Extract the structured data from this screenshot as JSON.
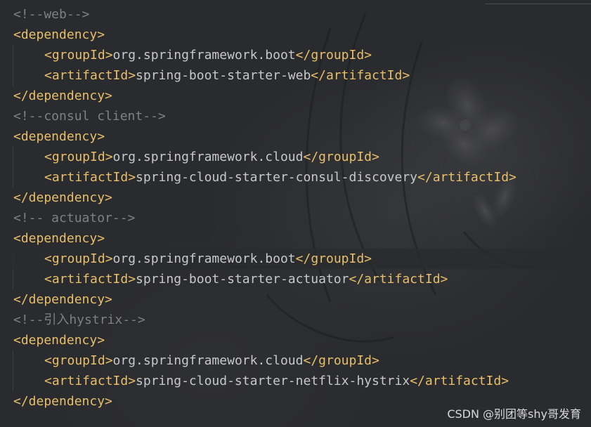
{
  "code_lines": [
    {
      "indent": 0,
      "comment": "<!--web-->"
    },
    {
      "indent": 0,
      "open": "<dependency>"
    },
    {
      "indent": 1,
      "open": "<groupId>",
      "text": "org.springframework.boot",
      "close": "</groupId>"
    },
    {
      "indent": 1,
      "open": "<artifactId>",
      "text": "spring-boot-starter-web",
      "close": "</artifactId>"
    },
    {
      "indent": 0,
      "close": "</dependency>"
    },
    {
      "indent": 0,
      "comment": "<!--consul client-->"
    },
    {
      "indent": 0,
      "open": "<dependency>"
    },
    {
      "indent": 1,
      "open": "<groupId>",
      "text": "org.springframework.cloud",
      "close": "</groupId>"
    },
    {
      "indent": 1,
      "open": "<artifactId>",
      "text": "spring-cloud-starter-consul-discovery",
      "close": "</artifactId>"
    },
    {
      "indent": 0,
      "close": "</dependency>"
    },
    {
      "indent": 0,
      "comment": "<!-- actuator-->"
    },
    {
      "indent": 0,
      "open": "<dependency>"
    },
    {
      "indent": 1,
      "open": "<groupId>",
      "text": "org.springframework.boot",
      "close": "</groupId>",
      "current": true
    },
    {
      "indent": 1,
      "open": "<artifactId>",
      "text": "spring-boot-starter-actuator",
      "close": "</artifactId>"
    },
    {
      "indent": 0,
      "close": "</dependency>"
    },
    {
      "indent": 0,
      "comment": "<!--引入hystrix-->"
    },
    {
      "indent": 0,
      "open": "<dependency>"
    },
    {
      "indent": 1,
      "open": "<groupId>",
      "text": "org.springframework.cloud",
      "close": "</groupId>"
    },
    {
      "indent": 1,
      "open": "<artifactId>",
      "text": "spring-cloud-starter-netflix-hystrix",
      "close": "</artifactId>"
    },
    {
      "indent": 0,
      "close": "</dependency>"
    }
  ],
  "watermark": "CSDN @别团等shy哥发育",
  "colors": {
    "tag": "#e8bf6a",
    "text": "#c8c8c8",
    "comment": "#7f8083",
    "background": "#2a2b2e"
  }
}
